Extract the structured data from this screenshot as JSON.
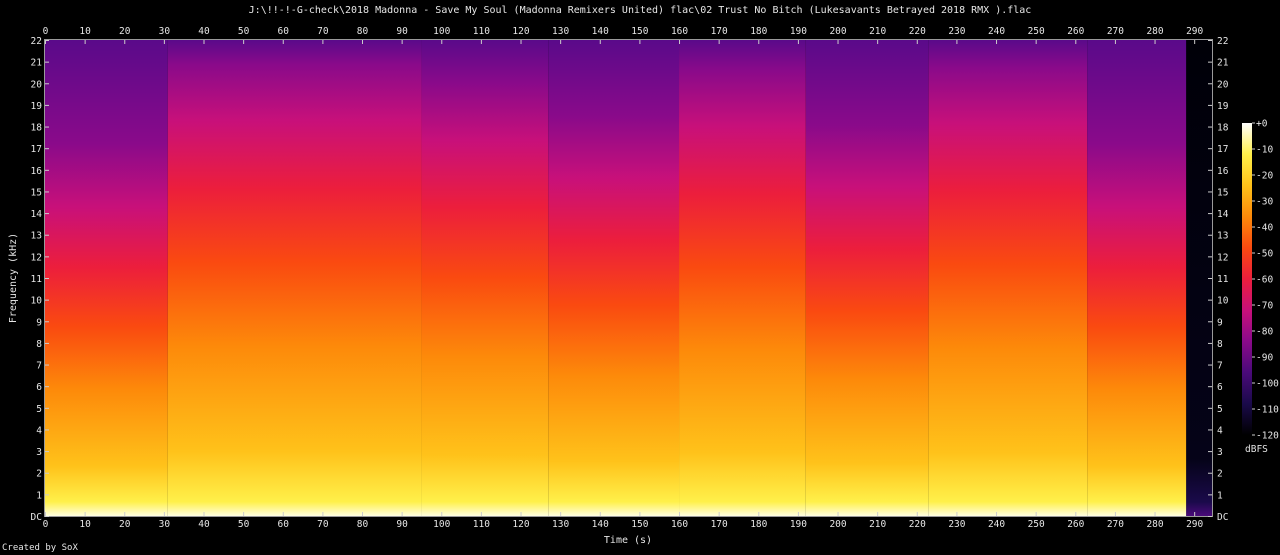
{
  "title": "J:\\!!-!-G-check\\2018 Madonna - Save My Soul (Madonna Remixers United) flac\\02 Trust No Bitch (Lukesavants Betrayed 2018 RMX ).flac",
  "footer": "Created by SoX",
  "chart_data": {
    "type": "heatmap",
    "xlabel": "Time (s)",
    "ylabel": "Frequency (kHz)",
    "xlim": [
      0,
      294.5
    ],
    "ylim": [
      0,
      22
    ],
    "x_ticks": [
      0,
      10,
      20,
      30,
      40,
      50,
      60,
      70,
      80,
      90,
      100,
      110,
      120,
      130,
      140,
      150,
      160,
      170,
      180,
      190,
      200,
      210,
      220,
      230,
      240,
      250,
      260,
      270,
      280,
      290
    ],
    "y_tick_labels": [
      "DC",
      "1",
      "2",
      "3",
      "4",
      "5",
      "6",
      "7",
      "8",
      "9",
      "10",
      "11",
      "12",
      "13",
      "14",
      "15",
      "16",
      "17",
      "18",
      "19",
      "20",
      "21",
      "22"
    ],
    "colorbar": {
      "label": "dBFS",
      "ticks": [
        "+0",
        "-10",
        "-20",
        "-30",
        "-40",
        "-50",
        "-60",
        "-70",
        "-80",
        "-90",
        "-100",
        "-110",
        "-120"
      ],
      "range": [
        -120,
        0
      ],
      "colors": [
        "#000000",
        "#1a0a4a",
        "#4a0a7a",
        "#8a0a8a",
        "#c8107a",
        "#ec1e3c",
        "#fa4a10",
        "#fd8a0a",
        "#ffc21a",
        "#fff04a",
        "#ffffff"
      ]
    },
    "segments": [
      {
        "start": 0,
        "end": 31,
        "intensity": 0.55
      },
      {
        "start": 31,
        "end": 95,
        "intensity": 0.85
      },
      {
        "start": 95,
        "end": 127,
        "intensity": 0.78
      },
      {
        "start": 127,
        "end": 160,
        "intensity": 0.65
      },
      {
        "start": 160,
        "end": 192,
        "intensity": 0.83
      },
      {
        "start": 192,
        "end": 223,
        "intensity": 0.62
      },
      {
        "start": 223,
        "end": 263,
        "intensity": 0.84
      },
      {
        "start": 263,
        "end": 288,
        "intensity": 0.55
      },
      {
        "start": 288,
        "end": 294.5,
        "intensity": 0.0
      }
    ]
  }
}
